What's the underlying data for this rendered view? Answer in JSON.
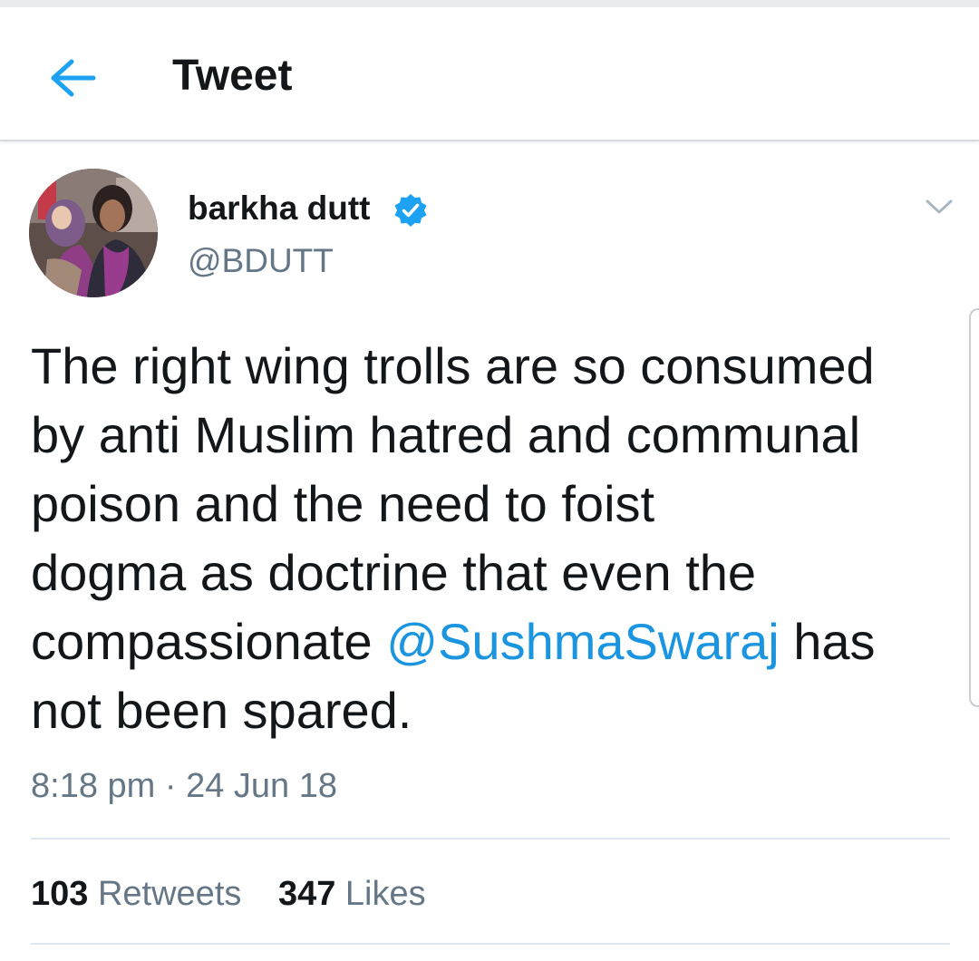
{
  "header": {
    "title": "Tweet",
    "back_icon": "arrow-left-icon",
    "accent_color": "#1da1f2"
  },
  "tweet": {
    "author": {
      "name": "barkha dutt",
      "handle": "@BDUTT",
      "verified_icon": "verified-badge-icon"
    },
    "text_lines": [
      "The right wing trolls are so consumed",
      "by anti Muslim hatred and communal",
      "poison and the need to foist",
      "dogma as doctrine that even the",
      "compassionate ",
      " has",
      "not been spared."
    ],
    "mention": "@SushmaSwaraj",
    "mention_color": "#1b95e0",
    "timestamp": "8:18 pm · 24 Jun 18",
    "stats": {
      "retweets_count": "103",
      "retweets_label": "Retweets",
      "likes_count": "347",
      "likes_label": "Likes"
    },
    "menu_icon": "chevron-down-icon"
  }
}
